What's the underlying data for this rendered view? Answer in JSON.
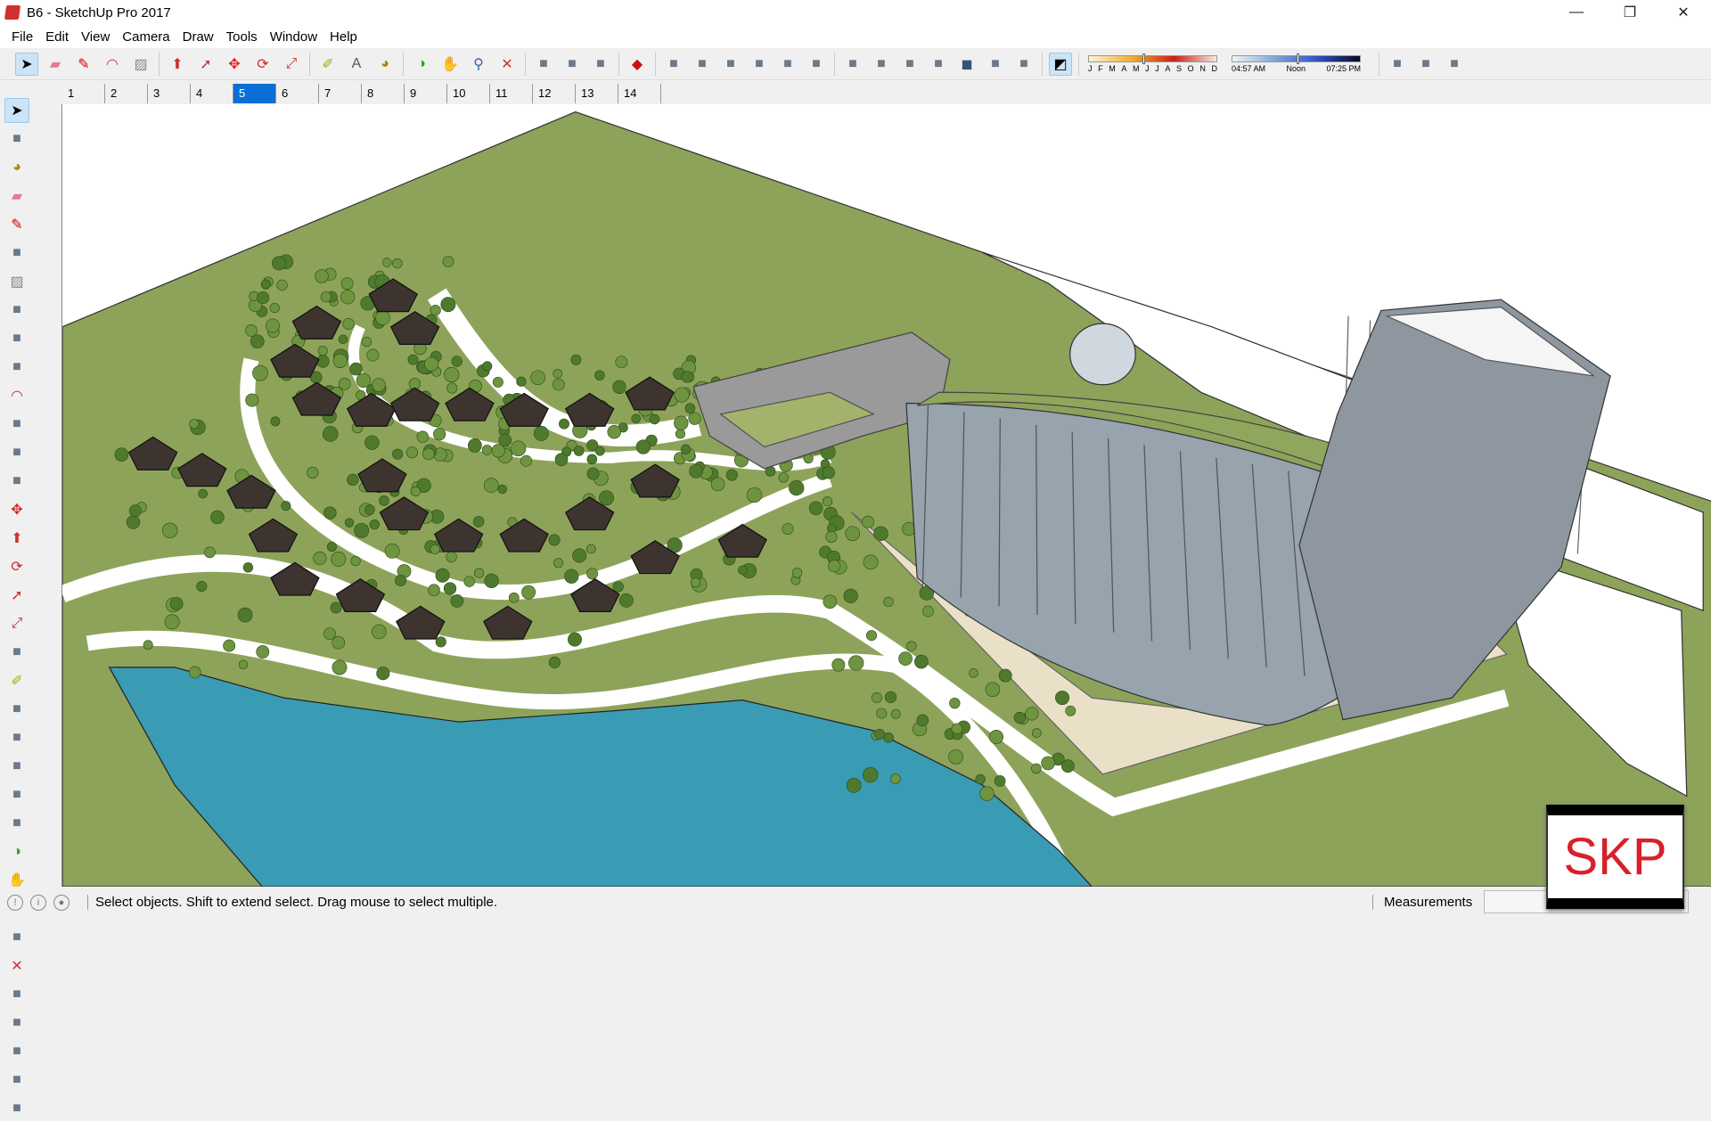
{
  "window": {
    "title": "B6 - SketchUp Pro 2017",
    "minimize": "—",
    "maximize": "❐",
    "close": "✕"
  },
  "menu": [
    "File",
    "Edit",
    "View",
    "Camera",
    "Draw",
    "Tools",
    "Window",
    "Help"
  ],
  "toolbar": {
    "groups": [
      [
        "select-icon",
        "eraser-icon",
        "pencil-line-icon",
        "arc-icon",
        "rectangle-icon"
      ],
      [
        "push-pull-icon",
        "follow-me-icon",
        "move-icon",
        "rotate-icon",
        "scale-icon"
      ],
      [
        "tape-measure-icon",
        "text-label-icon",
        "paint-bucket-icon"
      ],
      [
        "orbit-icon",
        "pan-icon",
        "zoom-icon",
        "zoom-extents-icon"
      ],
      [
        "3d-warehouse-icon",
        "extension-warehouse-icon",
        "layout-send-icon"
      ],
      [
        "ruby-extension-icon"
      ],
      [
        "iso-view-icon",
        "top-view-icon",
        "front-view-icon",
        "right-view-icon",
        "back-view-icon",
        "left-view-icon"
      ],
      [
        "xray-icon",
        "back-edges-icon",
        "wireframe-icon",
        "hidden-line-icon",
        "shaded-icon",
        "shaded-textures-icon",
        "monochrome-icon"
      ],
      [
        "shadows-toggle-icon"
      ]
    ],
    "trailing": [
      "add-location-icon",
      "toggle-terrain-icon",
      "photo-textures-icon"
    ]
  },
  "shadow": {
    "months": [
      "J",
      "F",
      "M",
      "A",
      "M",
      "J",
      "J",
      "A",
      "S",
      "O",
      "N",
      "D"
    ],
    "date_pos": 0.42,
    "time_start": "04:57 AM",
    "time_mid": "Noon",
    "time_end": "07:25 PM",
    "time_pos": 0.5
  },
  "scenes": {
    "tabs": [
      "1",
      "2",
      "3",
      "4",
      "5",
      "6",
      "7",
      "8",
      "9",
      "10",
      "11",
      "12",
      "13",
      "14"
    ],
    "selected": "5"
  },
  "left_tools": [
    "select-icon",
    "component-icon",
    "paint-bucket-icon",
    "eraser-icon",
    "line-icon",
    "freehand-icon",
    "rectangle-icon",
    "rotated-rectangle-icon",
    "circle-icon",
    "polygon-icon",
    "arc-icon",
    "pie-icon",
    "two-point-arc-icon",
    "three-point-arc-icon",
    "move-icon",
    "push-pull-icon",
    "rotate-icon",
    "follow-me-icon",
    "scale-icon",
    "offset-icon",
    "tape-measure-icon",
    "dimension-icon",
    "protractor-icon",
    "text-icon",
    "axes-icon",
    "3d-text-icon",
    "orbit-icon",
    "pan-icon",
    "zoom-icon",
    "zoom-window-icon",
    "zoom-extents-icon",
    "previous-view-icon",
    "position-camera-icon",
    "look-around-icon",
    "walk-icon",
    "section-plane-icon"
  ],
  "status": {
    "message": "Select objects. Shift to extend select. Drag mouse to select multiple.",
    "measurements_label": "Measurements",
    "measurements_value": ""
  },
  "watermark": "SKP"
}
